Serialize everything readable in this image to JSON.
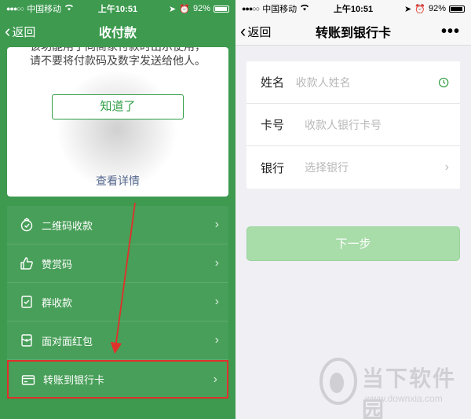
{
  "left": {
    "statusbar": {
      "carrier": "中国移动",
      "time": "上午10:51",
      "battery": "92%"
    },
    "nav": {
      "back": "返回",
      "title": "收付款"
    },
    "card": {
      "warning": "该功能用于向商家付款时出示使用，请不要将付款码及数字发送给他人。",
      "gotit_label": "知道了",
      "details_label": "查看详情"
    },
    "menu": [
      {
        "label": "二维码收款",
        "icon": "qr-collect-icon"
      },
      {
        "label": "赞赏码",
        "icon": "thumbs-up-icon"
      },
      {
        "label": "群收款",
        "icon": "group-collect-icon"
      },
      {
        "label": "面对面红包",
        "icon": "red-packet-icon"
      },
      {
        "label": "转账到银行卡",
        "icon": "bank-card-icon"
      }
    ]
  },
  "right": {
    "statusbar": {
      "carrier": "中国移动",
      "time": "上午10:51",
      "battery": "92%"
    },
    "nav": {
      "back": "返回",
      "title": "转账到银行卡",
      "more": "•••"
    },
    "form": {
      "name_label": "姓名",
      "name_placeholder": "收款人姓名",
      "card_label": "卡号",
      "card_placeholder": "收款人银行卡号",
      "bank_label": "银行",
      "bank_placeholder": "选择银行"
    },
    "next_label": "下一步"
  },
  "watermark": {
    "text": "当下软件园",
    "url": "www.downxia.com"
  },
  "colors": {
    "wechat_green": "#3d9a4f",
    "button_green": "#2e9d43",
    "highlight_red": "#e0312a",
    "disabled_green": "#a8dca9"
  }
}
